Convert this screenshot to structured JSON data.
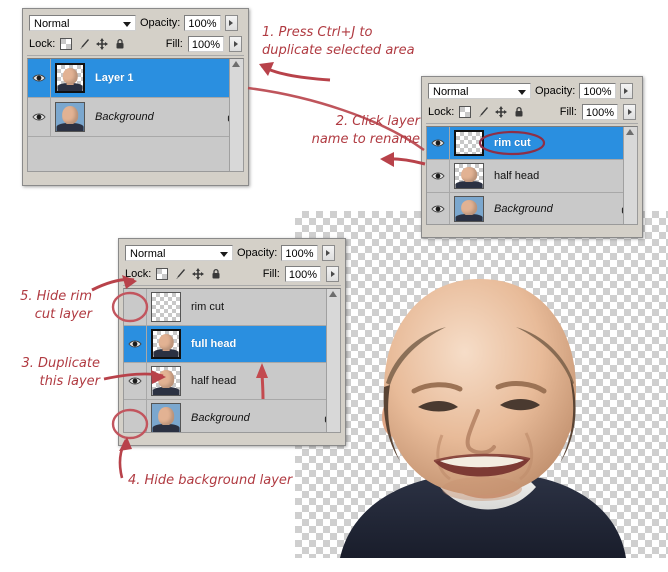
{
  "document": {
    "title": "Photoshop layers panel tutorial — head replacement steps"
  },
  "common": {
    "blend_mode": "Normal",
    "opacity_label": "Opacity:",
    "opacity_value": "100%",
    "lock_label": "Lock:",
    "fill_label": "Fill:",
    "fill_value": "100%",
    "lock_icons": [
      "transparent-pixels-icon",
      "brush-icon",
      "move-icon",
      "lock-all-icon"
    ],
    "selection_color": "#2a8fe0",
    "panel_bg": "#d4d0c8",
    "annotation_color": "#b03a41"
  },
  "panels": [
    {
      "id": "panel-1",
      "blend_mode": "Normal",
      "opacity_label": "Opacity:",
      "opacity_value": "100%",
      "lock_label": "Lock:",
      "fill_label": "Fill:",
      "fill_value": "100%",
      "layers": [
        {
          "name": "Layer 1",
          "visible": true,
          "selected": true,
          "locked": false,
          "italic": false,
          "thumb": "transparent-head"
        },
        {
          "name": "Background",
          "visible": true,
          "selected": false,
          "locked": true,
          "italic": true,
          "thumb": "sky-head"
        }
      ]
    },
    {
      "id": "panel-2",
      "blend_mode": "Normal",
      "opacity_label": "Opacity:",
      "opacity_value": "100%",
      "lock_label": "Lock:",
      "fill_label": "Fill:",
      "fill_value": "100%",
      "layers": [
        {
          "name": "rim cut",
          "visible": true,
          "selected": true,
          "locked": false,
          "italic": false,
          "thumb": "empty"
        },
        {
          "name": "half head",
          "visible": true,
          "selected": false,
          "locked": false,
          "italic": false,
          "thumb": "transparent-head"
        },
        {
          "name": "Background",
          "visible": true,
          "selected": false,
          "locked": true,
          "italic": true,
          "thumb": "sky-head"
        }
      ]
    },
    {
      "id": "panel-3",
      "blend_mode": "Normal",
      "opacity_label": "Opacity:",
      "opacity_value": "100%",
      "lock_label": "Lock:",
      "fill_label": "Fill:",
      "fill_value": "100%",
      "layers": [
        {
          "name": "rim cut",
          "visible": false,
          "selected": false,
          "locked": false,
          "italic": false,
          "thumb": "empty"
        },
        {
          "name": "full head",
          "visible": true,
          "selected": true,
          "locked": false,
          "italic": false,
          "thumb": "transparent-head"
        },
        {
          "name": "half head",
          "visible": true,
          "selected": false,
          "locked": false,
          "italic": false,
          "thumb": "transparent-head"
        },
        {
          "name": "Background",
          "visible": false,
          "selected": false,
          "locked": true,
          "italic": true,
          "thumb": "sky-head"
        }
      ]
    }
  ],
  "annotations": [
    {
      "id": "step-1",
      "text": "1. Press Ctrl+J to\nduplicate selected area"
    },
    {
      "id": "step-2",
      "text": "2. Click layer\nname to rename"
    },
    {
      "id": "step-3",
      "text": "3. Duplicate\nthis layer"
    },
    {
      "id": "step-4",
      "text": "4. Hide background layer"
    },
    {
      "id": "step-5",
      "text": "5. Hide rim\ncut layer"
    }
  ],
  "photo": {
    "alt": "Smiling bald man portrait on transparent checkerboard background"
  }
}
